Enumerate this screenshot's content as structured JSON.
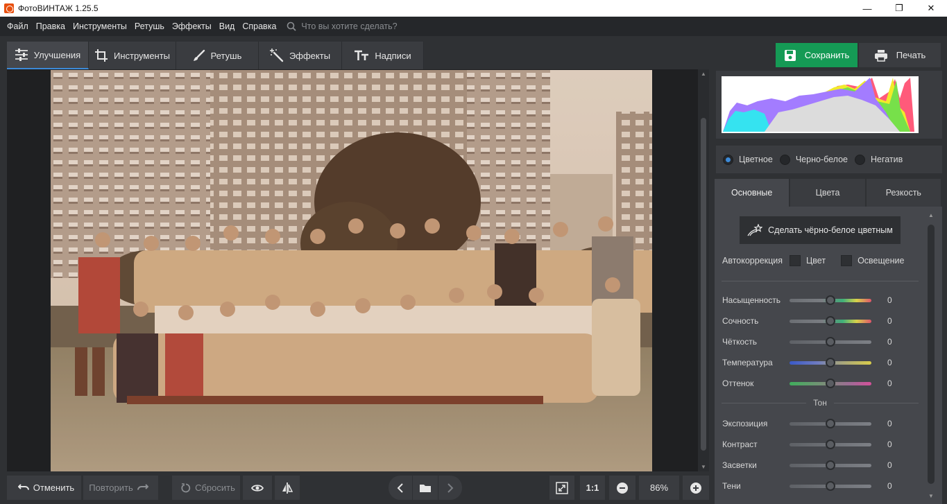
{
  "window": {
    "title": "ФотоВИНТАЖ 1.25.5",
    "minimize": "—",
    "maximize": "❐",
    "close": "✕"
  },
  "menu": {
    "items": [
      "Файл",
      "Правка",
      "Инструменты",
      "Ретушь",
      "Эффекты",
      "Вид",
      "Справка"
    ],
    "search_placeholder": "Что вы хотите сделать?"
  },
  "tabs": [
    {
      "label": "Улучшения",
      "icon": "sliders-icon",
      "active": true
    },
    {
      "label": "Инструменты",
      "icon": "crop-icon",
      "active": false
    },
    {
      "label": "Ретушь",
      "icon": "brush-icon",
      "active": false
    },
    {
      "label": "Эффекты",
      "icon": "magic-wand-icon",
      "active": false
    },
    {
      "label": "Надписи",
      "icon": "text-icon",
      "active": false
    }
  ],
  "actions": {
    "save": "Сохранить",
    "print": "Печать"
  },
  "bottom": {
    "undo": "Отменить",
    "redo": "Повторить",
    "reset": "Сбросить",
    "zoom_ratio": "1:1",
    "zoom_value": "86%"
  },
  "colors": {
    "accent": "#3c8ad8",
    "save_green": "#159a55",
    "panel": "#2f3134"
  },
  "modes": [
    {
      "label": "Цветное",
      "selected": true
    },
    {
      "label": "Черно-белое",
      "selected": false
    },
    {
      "label": "Негатив",
      "selected": false
    }
  ],
  "subtabs": [
    {
      "label": "Основные",
      "active": true
    },
    {
      "label": "Цвета",
      "active": false
    },
    {
      "label": "Резкость",
      "active": false
    }
  ],
  "settings": {
    "colorize_button": "Сделать чёрно-белое цветным",
    "autocorrection": {
      "label": "Автокоррекция",
      "color": "Цвет",
      "light": "Освещение"
    },
    "sliders": [
      {
        "label": "Насыщенность",
        "value": "0",
        "level": 0.5,
        "gradient": "saturation"
      },
      {
        "label": "Сочность",
        "value": "0",
        "level": 0.5,
        "gradient": "vibrance"
      },
      {
        "label": "Чёткость",
        "value": "0",
        "level": 0.5,
        "gradient": "gray"
      },
      {
        "label": "Температура",
        "value": "0",
        "level": 0.5,
        "gradient": "temperature"
      },
      {
        "label": "Оттенок",
        "value": "0",
        "level": 0.5,
        "gradient": "tint"
      }
    ],
    "tone_label": "Тон",
    "tone_sliders": [
      {
        "label": "Экспозиция",
        "value": "0",
        "level": 0.5,
        "gradient": "gray"
      },
      {
        "label": "Контраст",
        "value": "0",
        "level": 0.5,
        "gradient": "gray"
      },
      {
        "label": "Засветки",
        "value": "0",
        "level": 0.5,
        "gradient": "gray"
      },
      {
        "label": "Тени",
        "value": "0",
        "level": 0.5,
        "gradient": "gray"
      }
    ]
  }
}
